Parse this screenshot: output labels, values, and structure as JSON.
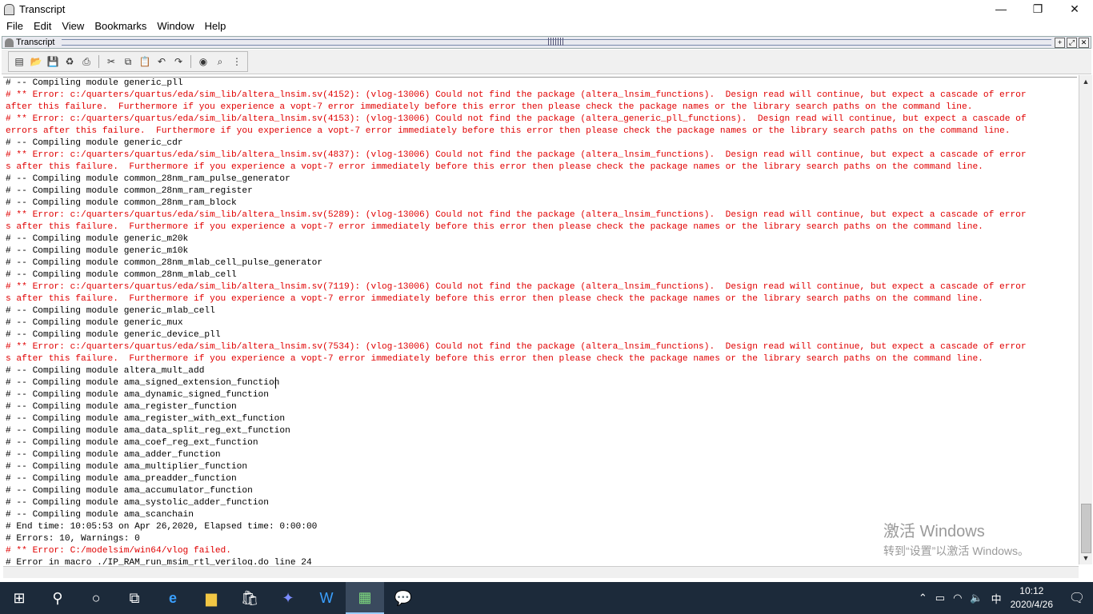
{
  "window": {
    "title": "Transcript",
    "controls": {
      "minimize": "—",
      "maximize": "❐",
      "close": "✕"
    }
  },
  "menu": [
    "File",
    "Edit",
    "View",
    "Bookmarks",
    "Window",
    "Help"
  ],
  "panel": {
    "title": "Transcript",
    "buttons": [
      "+",
      "⤢",
      "✕"
    ]
  },
  "toolbar": {
    "icons": [
      "new-icon",
      "open-icon",
      "save-icon",
      "reload-icon",
      "print-icon",
      "cut-icon",
      "copy-icon",
      "paste-icon",
      "undo-icon",
      "redo-icon",
      "help-icon",
      "find-icon",
      "options-icon"
    ]
  },
  "transcript": {
    "lines": [
      {
        "text": "# -- Compiling module generic_pll",
        "error": false
      },
      {
        "text": "# ** Error: c:/quarters/quartus/eda/sim_lib/altera_lnsim.sv(4152): (vlog-13006) Could not find the package (altera_lnsim_functions).  Design read will continue, but expect a cascade of error",
        "error": true
      },
      {
        "text": "after this failure.  Furthermore if you experience a vopt-7 error immediately before this error then please check the package names or the library search paths on the command line.",
        "error": true
      },
      {
        "text": "# ** Error: c:/quarters/quartus/eda/sim_lib/altera_lnsim.sv(4153): (vlog-13006) Could not find the package (altera_generic_pll_functions).  Design read will continue, but expect a cascade of",
        "error": true
      },
      {
        "text": "errors after this failure.  Furthermore if you experience a vopt-7 error immediately before this error then please check the package names or the library search paths on the command line.",
        "error": true
      },
      {
        "text": "# -- Compiling module generic_cdr",
        "error": false
      },
      {
        "text": "# ** Error: c:/quarters/quartus/eda/sim_lib/altera_lnsim.sv(4837): (vlog-13006) Could not find the package (altera_lnsim_functions).  Design read will continue, but expect a cascade of error",
        "error": true
      },
      {
        "text": "s after this failure.  Furthermore if you experience a vopt-7 error immediately before this error then please check the package names or the library search paths on the command line.",
        "error": true
      },
      {
        "text": "# -- Compiling module common_28nm_ram_pulse_generator",
        "error": false
      },
      {
        "text": "# -- Compiling module common_28nm_ram_register",
        "error": false
      },
      {
        "text": "# -- Compiling module common_28nm_ram_block",
        "error": false
      },
      {
        "text": "# ** Error: c:/quarters/quartus/eda/sim_lib/altera_lnsim.sv(5289): (vlog-13006) Could not find the package (altera_lnsim_functions).  Design read will continue, but expect a cascade of error",
        "error": true
      },
      {
        "text": "s after this failure.  Furthermore if you experience a vopt-7 error immediately before this error then please check the package names or the library search paths on the command line.",
        "error": true
      },
      {
        "text": "# -- Compiling module generic_m20k",
        "error": false
      },
      {
        "text": "# -- Compiling module generic_m10k",
        "error": false
      },
      {
        "text": "# -- Compiling module common_28nm_mlab_cell_pulse_generator",
        "error": false
      },
      {
        "text": "# -- Compiling module common_28nm_mlab_cell",
        "error": false
      },
      {
        "text": "# ** Error: c:/quarters/quartus/eda/sim_lib/altera_lnsim.sv(7119): (vlog-13006) Could not find the package (altera_lnsim_functions).  Design read will continue, but expect a cascade of error",
        "error": true
      },
      {
        "text": "s after this failure.  Furthermore if you experience a vopt-7 error immediately before this error then please check the package names or the library search paths on the command line.",
        "error": true
      },
      {
        "text": "# -- Compiling module generic_mlab_cell",
        "error": false
      },
      {
        "text": "# -- Compiling module generic_mux",
        "error": false
      },
      {
        "text": "# -- Compiling module generic_device_pll",
        "error": false
      },
      {
        "text": "# ** Error: c:/quarters/quartus/eda/sim_lib/altera_lnsim.sv(7534): (vlog-13006) Could not find the package (altera_lnsim_functions).  Design read will continue, but expect a cascade of error",
        "error": true
      },
      {
        "text": "s after this failure.  Furthermore if you experience a vopt-7 error immediately before this error then please check the package names or the library search paths on the command line.",
        "error": true
      },
      {
        "text": "# -- Compiling module altera_mult_add",
        "error": false
      },
      {
        "text": "# -- Compiling module ama_signed_extension_function",
        "error": false
      },
      {
        "text": "# -- Compiling module ama_dynamic_signed_function",
        "error": false
      },
      {
        "text": "# -- Compiling module ama_register_function",
        "error": false
      },
      {
        "text": "# -- Compiling module ama_register_with_ext_function",
        "error": false
      },
      {
        "text": "# -- Compiling module ama_data_split_reg_ext_function",
        "error": false
      },
      {
        "text": "# -- Compiling module ama_coef_reg_ext_function",
        "error": false
      },
      {
        "text": "# -- Compiling module ama_adder_function",
        "error": false
      },
      {
        "text": "# -- Compiling module ama_multiplier_function",
        "error": false
      },
      {
        "text": "# -- Compiling module ama_preadder_function",
        "error": false
      },
      {
        "text": "# -- Compiling module ama_accumulator_function",
        "error": false
      },
      {
        "text": "# -- Compiling module ama_systolic_adder_function",
        "error": false
      },
      {
        "text": "# -- Compiling module ama_scanchain",
        "error": false
      },
      {
        "text": "# End time: 10:05:53 on Apr 26,2020, Elapsed time: 0:00:00",
        "error": false
      },
      {
        "text": "# Errors: 10, Warnings: 0",
        "error": false
      },
      {
        "text": "# ** Error: C:/modelsim/win64/vlog failed.",
        "error": true
      },
      {
        "text": "# Error in macro ./IP_RAM_run_msim_rtl_verilog.do line 24",
        "error": false
      }
    ]
  },
  "watermark": {
    "line1": "激活 Windows",
    "line2": "转到“设置”以激活 Windows。"
  },
  "taskbar": {
    "apps": [
      "start-icon",
      "search-icon",
      "cortana-icon",
      "task-view-icon",
      "edge-icon",
      "file-explorer-icon",
      "store-icon",
      "app-icon",
      "wps-icon",
      "modelsim-icon",
      "wechat-icon"
    ],
    "tray": {
      "ime": "中",
      "time": "10:12",
      "date": "2020/4/26"
    }
  },
  "colors": {
    "error_text": "#e00000",
    "normal_text": "#000000",
    "taskbar": "#1c2a3a"
  }
}
